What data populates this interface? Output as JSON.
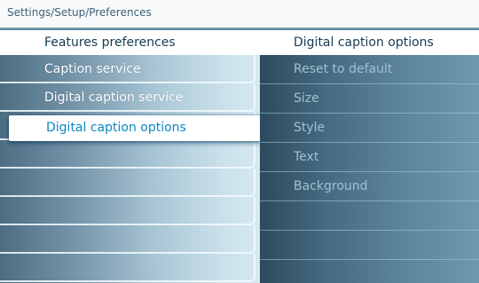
{
  "breadcrumb": "Settings/Setup/Preferences",
  "left_column": {
    "header": "Features preferences",
    "items": [
      {
        "label": "Caption service"
      },
      {
        "label": "Digital caption service"
      },
      {
        "label": "Digital caption options"
      },
      {
        "label": ""
      },
      {
        "label": ""
      },
      {
        "label": ""
      },
      {
        "label": ""
      },
      {
        "label": ""
      }
    ],
    "selected_index": 2
  },
  "right_column": {
    "header": "Digital caption options",
    "items": [
      {
        "label": "Reset to default"
      },
      {
        "label": "Size"
      },
      {
        "label": "Style"
      },
      {
        "label": "Text"
      },
      {
        "label": "Background"
      },
      {
        "label": ""
      },
      {
        "label": ""
      },
      {
        "label": ""
      }
    ]
  },
  "colors": {
    "selected_text": "#0c86c4",
    "header_text": "#163a52",
    "breadcrumb_text": "#3d6176",
    "right_item_text": "#9fc1d4"
  }
}
